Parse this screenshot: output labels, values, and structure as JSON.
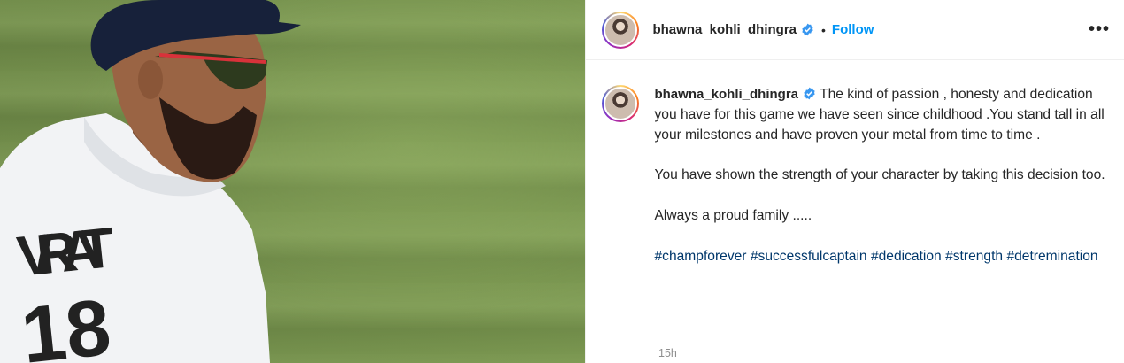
{
  "post": {
    "username": "bhawna_kohli_dhingra",
    "follow_label": "Follow",
    "dot": "•",
    "more_label": "•••",
    "caption": {
      "username": "bhawna_kohli_dhingra",
      "line1": "The kind of passion , honesty and dedication you have for this game we have seen since childhood .You stand tall in all your milestones and have proven your metal from time to time .",
      "line2": "You have shown the strength of your character by taking this decision too.",
      "line3": "Always a proud family .....",
      "hashtags": [
        "#champforever",
        "#successfulcaptain",
        "#dedication",
        "#strength",
        "#detremination"
      ]
    },
    "timestamp": "15h"
  },
  "media": {
    "jersey_text": "VIRAT",
    "jersey_number": "18"
  },
  "colors": {
    "accent": "#0095f6",
    "hashtag": "#00376b",
    "verified": "#3897f0"
  }
}
